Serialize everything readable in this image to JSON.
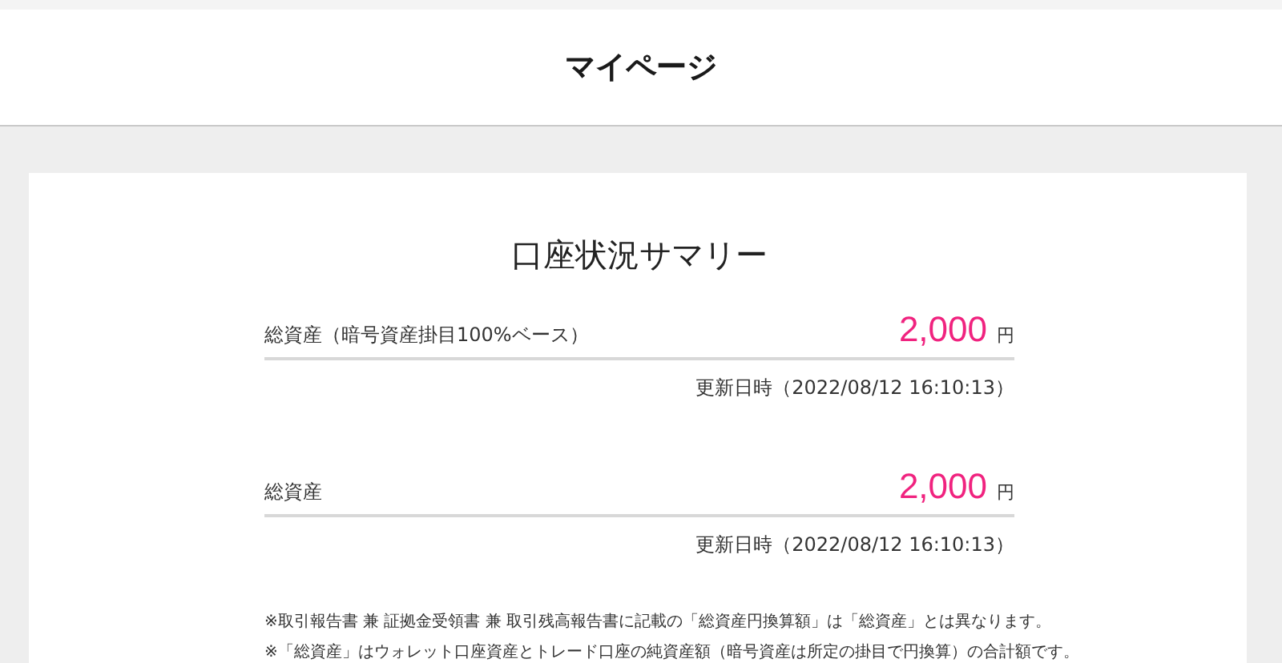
{
  "header": {
    "title": "マイページ"
  },
  "summary": {
    "title": "口座状況サマリー",
    "rows": [
      {
        "label": "総資産（暗号資産掛目100%ベース）",
        "amount": "2,000",
        "unit": "円",
        "updated": "更新日時（2022/08/12 16:10:13）"
      },
      {
        "label": "総資産",
        "amount": "2,000",
        "unit": "円",
        "updated": "更新日時（2022/08/12 16:10:13）"
      }
    ],
    "notes": [
      "※取引報告書 兼 証拠金受領書 兼 取引残高報告書に記載の「総資産円換算額」は「総資産」とは異なります。",
      "※「総資産」はウォレット口座資産とトレード口座の純資産額（暗号資産は所定の掛目で円換算）の合計額です。"
    ]
  }
}
